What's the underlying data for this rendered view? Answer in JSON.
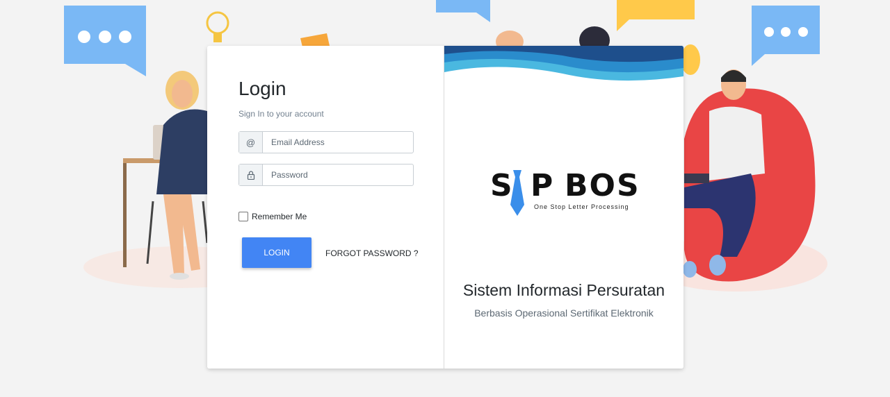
{
  "login": {
    "title": "Login",
    "subtitle": "Sign In to your account",
    "email_addon": "@",
    "email_placeholder": "Email Address",
    "password_icon": "lock-icon",
    "password_placeholder": "Password",
    "remember_label": "Remember Me",
    "login_button": "LOGIN",
    "forgot_link": "FORGOT PASSWORD ?"
  },
  "brand": {
    "logo_left": "S",
    "logo_mid": "P",
    "logo_right": "BOS",
    "logo_tagline": "One Stop Letter Processing",
    "title": "Sistem Informasi Persuratan",
    "subtitle": "Berbasis Operasional Sertifikat Elektronik"
  },
  "colors": {
    "primary_button": "#4285f4",
    "wave_dark": "#1e4f8c",
    "wave_mid": "#2a8ccc",
    "wave_light": "#4ab8e0",
    "tie_blue": "#3a8eea",
    "background": "#f3f3f3"
  },
  "icons": [
    "chat-bubble-icon",
    "lightbulb-icon",
    "envelope-icon",
    "lock-icon",
    "necktie-icon"
  ]
}
